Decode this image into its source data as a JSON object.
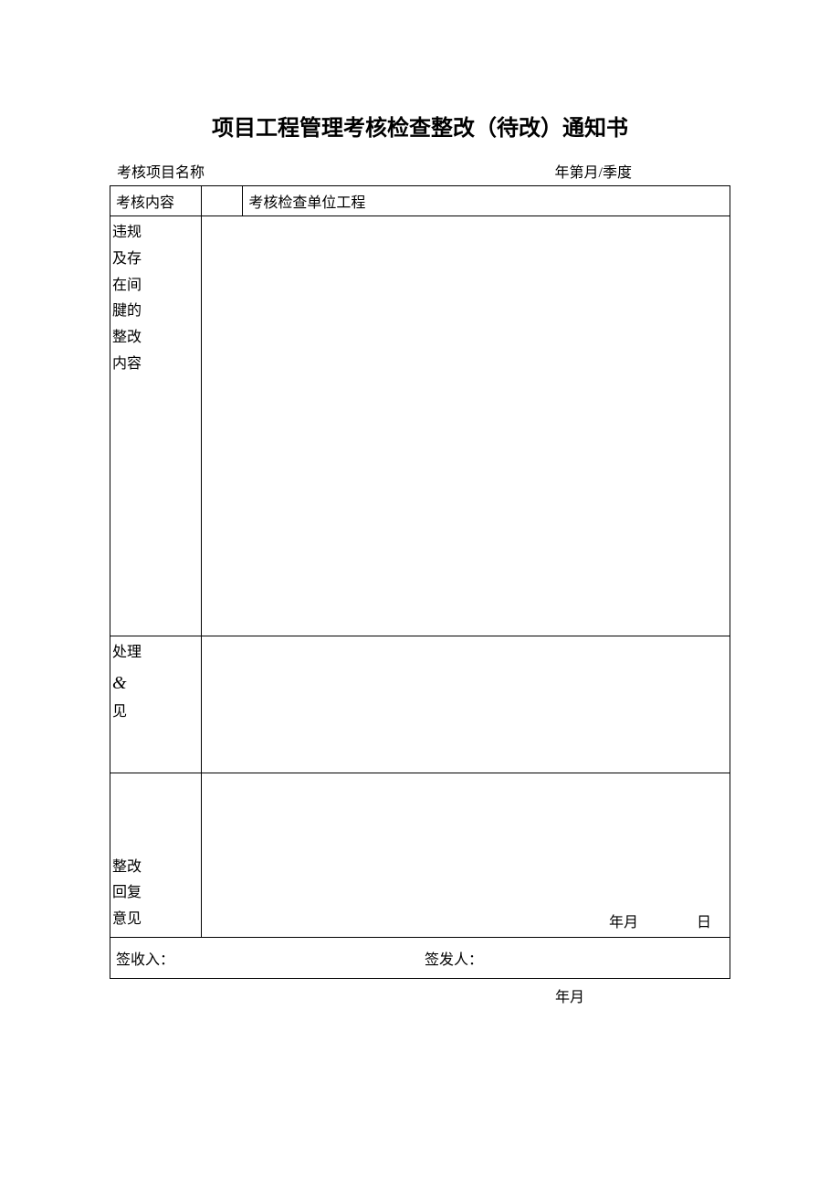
{
  "title": "项目工程管理考核检查整改（待改）通知书",
  "header": {
    "project_name_label": "考核项目名称",
    "period_label": "年第月/季度"
  },
  "row_examine": {
    "content_label": "考核内容",
    "unit_label": "考核检查单位工程"
  },
  "violation_label": {
    "l1": "违规",
    "l2": "及存",
    "l3": "在间",
    "l4": "腱的",
    "l5": "整改",
    "l6": "内容"
  },
  "opinion_label": {
    "l1": "处理",
    "l2": "&",
    "l3": "见"
  },
  "reply_label": {
    "l1": "整改",
    "l2": "回复",
    "l3": "意见"
  },
  "reply_date": {
    "ym": "年月",
    "d": "日"
  },
  "sign": {
    "receiver": "签收入：",
    "issuer": "签发人："
  },
  "footer_date": "年月"
}
